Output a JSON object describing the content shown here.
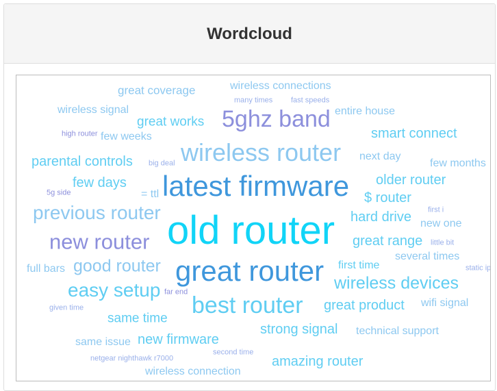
{
  "panel": {
    "title": "Wordcloud"
  },
  "colors": {
    "light_blue": "#8dc8f0",
    "sky": "#5fcdf2",
    "cyan": "#11d4f7",
    "blue": "#3f97dc",
    "lavender": "#8c8fdc",
    "pale": "#9ab0ea"
  },
  "cloud": {
    "words": [
      {
        "text": "great coverage",
        "color": "#8dc8f0"
      },
      {
        "text": "wireless connections",
        "color": "#8dc8f0"
      },
      {
        "text": "many times",
        "color": "#9ab0ea"
      },
      {
        "text": "fast speeds",
        "color": "#9ab0ea"
      },
      {
        "text": "wireless signal",
        "color": "#8dc8f0"
      },
      {
        "text": "great works",
        "color": "#5fcdf2"
      },
      {
        "text": "5ghz band",
        "color": "#8c8fdc"
      },
      {
        "text": "entire house",
        "color": "#8dc8f0"
      },
      {
        "text": "high router",
        "color": "#8c8fdc"
      },
      {
        "text": "few weeks",
        "color": "#8dc8f0"
      },
      {
        "text": "smart connect",
        "color": "#5fcdf2"
      },
      {
        "text": "wireless router",
        "color": "#8dc8f0"
      },
      {
        "text": "parental controls",
        "color": "#5fcdf2"
      },
      {
        "text": "big deal",
        "color": "#9ab0ea"
      },
      {
        "text": "next day",
        "color": "#8dc8f0"
      },
      {
        "text": "few months",
        "color": "#8dc8f0"
      },
      {
        "text": "latest firmware",
        "color": "#3f97dc"
      },
      {
        "text": "few days",
        "color": "#5fcdf2"
      },
      {
        "text": "older router",
        "color": "#5fcdf2"
      },
      {
        "text": "5g side",
        "color": "#8c8fdc"
      },
      {
        "text": "= ttl",
        "color": "#8dc8f0"
      },
      {
        "text": "$ router",
        "color": "#5fcdf2"
      },
      {
        "text": "previous router",
        "color": "#8dc8f0"
      },
      {
        "text": "first i",
        "color": "#9ab0ea"
      },
      {
        "text": "hard drive",
        "color": "#5fcdf2"
      },
      {
        "text": "new one",
        "color": "#8dc8f0"
      },
      {
        "text": "old router",
        "color": "#11d4f7"
      },
      {
        "text": "new router",
        "color": "#8c8fdc"
      },
      {
        "text": "great range",
        "color": "#5fcdf2"
      },
      {
        "text": "little bit",
        "color": "#9ab0ea"
      },
      {
        "text": "several times",
        "color": "#8dc8f0"
      },
      {
        "text": "full bars",
        "color": "#8dc8f0"
      },
      {
        "text": "good router",
        "color": "#8dc8f0"
      },
      {
        "text": "great router",
        "color": "#3f97dc"
      },
      {
        "text": "first time",
        "color": "#5fcdf2"
      },
      {
        "text": "static ip",
        "color": "#9ab0ea"
      },
      {
        "text": "easy setup",
        "color": "#5fcdf2"
      },
      {
        "text": "far end",
        "color": "#8c8fdc"
      },
      {
        "text": "wireless devices",
        "color": "#5fcdf2"
      },
      {
        "text": "best router",
        "color": "#5fcdf2"
      },
      {
        "text": "great product",
        "color": "#5fcdf2"
      },
      {
        "text": "wifi signal",
        "color": "#8dc8f0"
      },
      {
        "text": "given time",
        "color": "#9ab0ea"
      },
      {
        "text": "same time",
        "color": "#5fcdf2"
      },
      {
        "text": "strong signal",
        "color": "#5fcdf2"
      },
      {
        "text": "technical support",
        "color": "#8dc8f0"
      },
      {
        "text": "same issue",
        "color": "#8dc8f0"
      },
      {
        "text": "new firmware",
        "color": "#5fcdf2"
      },
      {
        "text": "netgear nighthawk r7000",
        "color": "#9ab0ea"
      },
      {
        "text": "second time",
        "color": "#9ab0ea"
      },
      {
        "text": "amazing router",
        "color": "#5fcdf2"
      },
      {
        "text": "wireless connection",
        "color": "#8dc8f0"
      }
    ]
  }
}
